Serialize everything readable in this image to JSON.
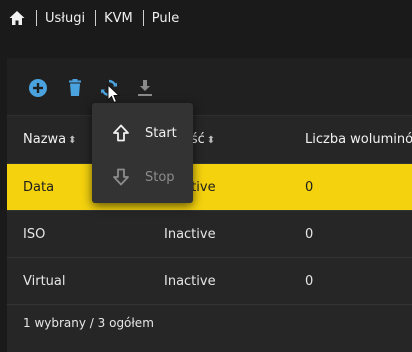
{
  "breadcrumb": {
    "items": [
      "Usługi",
      "KVM",
      "Pule"
    ]
  },
  "toolbar": {
    "buttons": [
      {
        "icon": "add-icon",
        "color": "#4aa3df"
      },
      {
        "icon": "trash-icon",
        "color": "#4aa3df"
      },
      {
        "icon": "refresh-icon",
        "color": "#4aa3df"
      },
      {
        "icon": "download-icon",
        "color": "#8a8a8a"
      }
    ]
  },
  "dropdown": {
    "start_label": "Start",
    "stop_label": "Stop"
  },
  "table": {
    "headers": [
      "Nazwa",
      "wność",
      "Liczba woluminów"
    ],
    "rows": [
      {
        "name": "Data",
        "status": "Inactive",
        "volumes": "0",
        "selected": true
      },
      {
        "name": "ISO",
        "status": "Inactive",
        "volumes": "0",
        "selected": false
      },
      {
        "name": "Virtual",
        "status": "Inactive",
        "volumes": "0",
        "selected": false
      }
    ]
  },
  "footer": {
    "summary": "1 wybrany / 3 ogółem"
  },
  "colors": {
    "accent": "#4aa3df",
    "selected_row": "#f4d20e"
  }
}
